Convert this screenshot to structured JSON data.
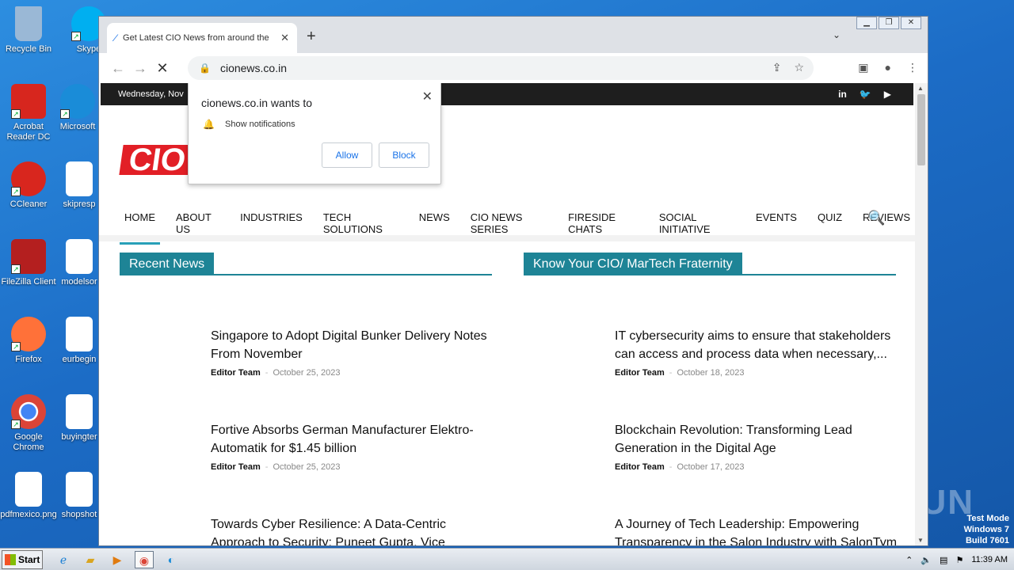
{
  "desktop": {
    "icons": [
      {
        "label": "Recycle Bin",
        "color": "#9ab8d6"
      },
      {
        "label": "Skype",
        "color": "#00aff0"
      },
      {
        "label": "Acrobat Reader DC",
        "color": "#d7261e"
      },
      {
        "label": "Microsoft",
        "color": "#1a8cd8"
      },
      {
        "label": "CCleaner",
        "color": "#d8261e"
      },
      {
        "label": "skipresp",
        "color": "#ffffff"
      },
      {
        "label": "FileZilla Client",
        "color": "#b41f1f"
      },
      {
        "label": "modelsor",
        "color": "#ffffff"
      },
      {
        "label": "Firefox",
        "color": "#ff7139"
      },
      {
        "label": "eurbegin",
        "color": "#ffffff"
      },
      {
        "label": "Google Chrome",
        "color": "#4285f4"
      },
      {
        "label": "buyingter",
        "color": "#ffffff"
      },
      {
        "label": "pdfmexico.png",
        "color": "#ffffff"
      },
      {
        "label": "shopshot",
        "color": "#ffffff"
      }
    ],
    "watermark": "ANY RUN",
    "test_mode": [
      "Test Mode",
      "Windows 7",
      "Build 7601"
    ]
  },
  "browser": {
    "tab_title": "Get Latest CIO News from around the",
    "tab_favicon": "loading-spinner",
    "new_tab": "+",
    "url": "cionews.co.in",
    "window_controls": [
      "minimize",
      "maximize",
      "close"
    ]
  },
  "page": {
    "date_text": "Wednesday, Nov",
    "social": [
      "in",
      "twitter",
      "youtube"
    ],
    "logo_text": "CIO",
    "nav": [
      "HOME",
      "ABOUT US",
      "INDUSTRIES",
      "TECH SOLUTIONS",
      "NEWS",
      "CIO NEWS SERIES",
      "FIRESIDE CHATS",
      "SOCIAL INITIATIVE",
      "EVENTS",
      "QUIZ",
      "REVIEWS"
    ],
    "sections": {
      "recent": {
        "heading": "Recent News",
        "articles": [
          {
            "title": "Singapore to Adopt Digital Bunker Delivery Notes From November",
            "author": "Editor Team",
            "date": "October 25, 2023"
          },
          {
            "title": "Fortive Absorbs German Manufacturer Elektro-Automatik for $1.45 billion",
            "author": "Editor Team",
            "date": "October 25, 2023"
          },
          {
            "title": "Towards Cyber Resilience: A Data-Centric Approach to Security: Puneet Gupta, Vice President & Managing",
            "author": "",
            "date": ""
          }
        ]
      },
      "fraternity": {
        "heading": "Know Your CIO/ MarTech Fraternity",
        "articles": [
          {
            "title": "IT cybersecurity aims to ensure that stakeholders can access and process data when necessary,...",
            "author": "Editor Team",
            "date": "October 18, 2023"
          },
          {
            "title": "Blockchain Revolution: Transforming Lead Generation in the Digital Age",
            "author": "Editor Team",
            "date": "October 17, 2023"
          },
          {
            "title": "A Journey of Tech Leadership: Empowering Transparency in the Salon Industry with SalonTym",
            "author": "",
            "date": ""
          }
        ]
      }
    }
  },
  "popup": {
    "heading": "cionews.co.in wants to",
    "permission": "Show notifications",
    "allow": "Allow",
    "block": "Block"
  },
  "taskbar": {
    "start": "Start",
    "clock": "11:39 AM"
  }
}
